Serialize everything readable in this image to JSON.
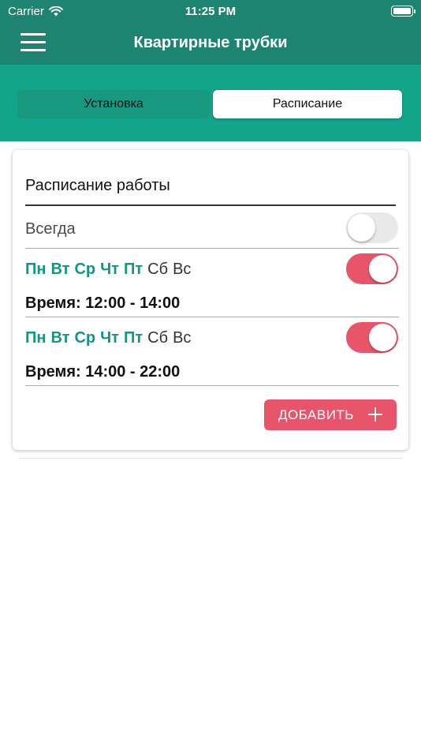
{
  "status_bar": {
    "carrier": "Carrier",
    "time": "11:25 PM",
    "wifi_icon": "wifi-icon",
    "battery_icon": "battery-full-icon"
  },
  "nav": {
    "title": "Квартирные трубки",
    "menu_icon": "hamburger-menu-icon",
    "background_color": "#1e8472"
  },
  "tabs": [
    {
      "label": "Установка",
      "selected": false
    },
    {
      "label": "Расписание",
      "selected": true
    }
  ],
  "tab_band_color": "#13a58c",
  "schedule": {
    "title": "Расписание работы",
    "always": {
      "label": "Всегда",
      "enabled": false
    },
    "entries": [
      {
        "days": [
          {
            "label": "Пн",
            "active": true
          },
          {
            "label": "Вт",
            "active": true
          },
          {
            "label": "Ср",
            "active": true
          },
          {
            "label": "Чт",
            "active": true
          },
          {
            "label": "Пт",
            "active": true
          },
          {
            "label": "Сб",
            "active": false
          },
          {
            "label": "Вс",
            "active": false
          }
        ],
        "enabled": true,
        "time_text": "Время: 12:00 - 14:00"
      },
      {
        "days": [
          {
            "label": "Пн",
            "active": true
          },
          {
            "label": "Вт",
            "active": true
          },
          {
            "label": "Ср",
            "active": true
          },
          {
            "label": "Чт",
            "active": true
          },
          {
            "label": "Пт",
            "active": true
          },
          {
            "label": "Сб",
            "active": false
          },
          {
            "label": "Вс",
            "active": false
          }
        ],
        "enabled": true,
        "time_text": "Время: 14:00 - 22:00"
      }
    ],
    "add_button": {
      "label": "ДОБАВИТЬ",
      "icon": "plus-icon"
    }
  },
  "colors": {
    "accent_green": "#14967f",
    "toggle_on": "#e8556a",
    "toggle_off": "#e9e9ea",
    "add_button": "#e8556a"
  }
}
